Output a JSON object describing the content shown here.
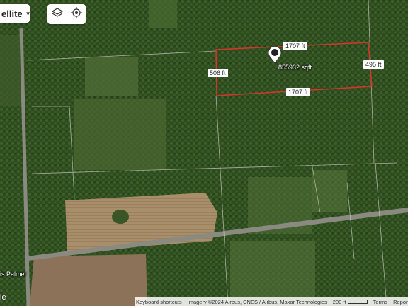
{
  "map_type": {
    "label": "ellite"
  },
  "tools": {
    "layers_icon": "layers-icon",
    "location_icon": "crosshair-icon"
  },
  "measurement": {
    "top_edge": "1707 ft",
    "bottom_edge": "1707 ft",
    "left_edge": "506 ft",
    "right_edge": "495 ft",
    "area": "855932 sqft",
    "outline_color": "#d9352a"
  },
  "road_label": "is Palmer",
  "google_partial": "le",
  "footer": {
    "shortcuts": "Keyboard shortcuts",
    "imagery": "Imagery ©2024 Airbus, CNES / Airbus, Maxar Technologies",
    "scale": "200 ft",
    "terms": "Terms",
    "report": "Report a"
  }
}
